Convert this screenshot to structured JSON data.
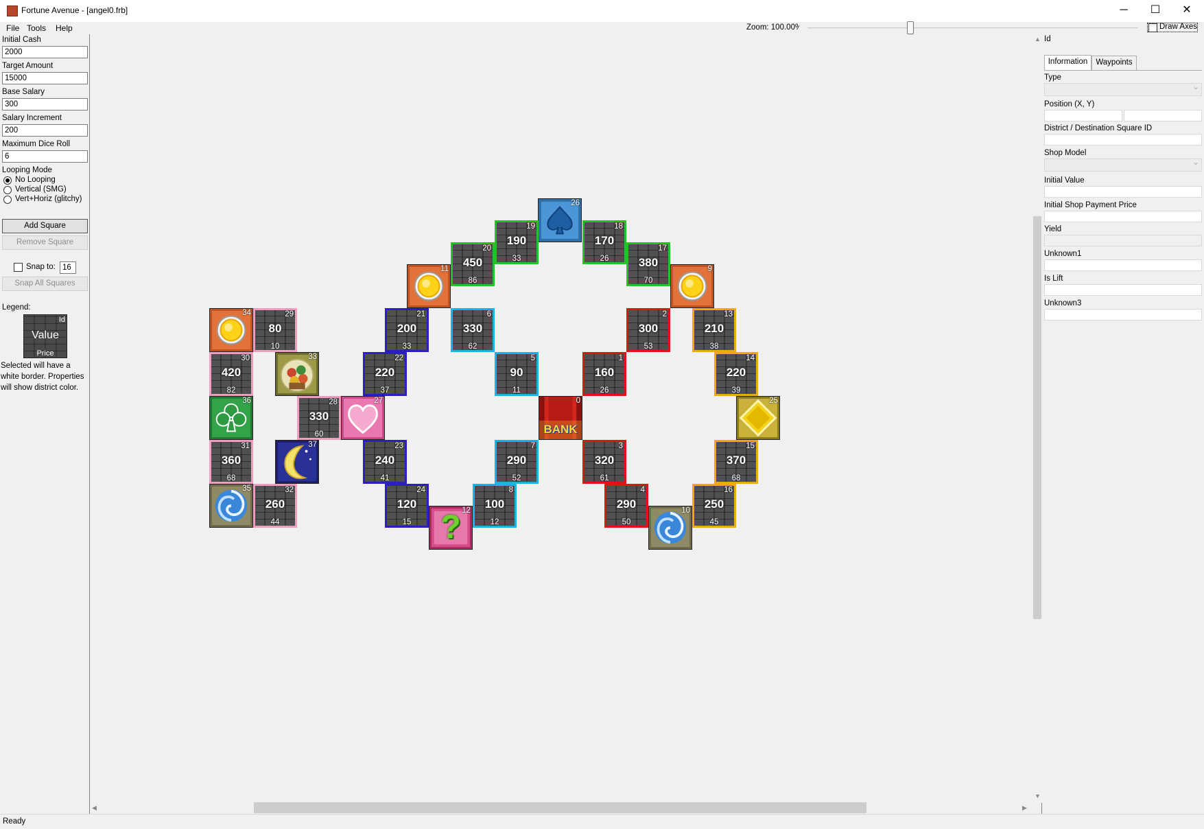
{
  "window": {
    "title": "Fortune Avenue - [angel0.frb]",
    "minimize_glyph": "─",
    "maximize_glyph": "☐",
    "close_glyph": "✕"
  },
  "menu": {
    "file": "File",
    "tools": "Tools",
    "help": "Help"
  },
  "toolbar": {
    "zoom_label": "Zoom: 100.00%",
    "zoom_level": 0.3,
    "draw_axes_label": "Draw Axes",
    "draw_axes_checked": false
  },
  "left_panel": {
    "initial_cash_label": "Initial Cash",
    "initial_cash_value": "2000",
    "target_amount_label": "Target Amount",
    "target_amount_value": "15000",
    "base_salary_label": "Base Salary",
    "base_salary_value": "300",
    "salary_increment_label": "Salary Increment",
    "salary_increment_value": "200",
    "max_dice_label": "Maximum Dice Roll",
    "max_dice_value": "6",
    "looping_mode_label": "Looping Mode",
    "looping_options": [
      "No Looping",
      "Vertical (SMG)",
      "Vert+Horiz (glitchy)"
    ],
    "looping_selected": "No Looping",
    "add_square_label": "Add Square",
    "remove_square_label": "Remove Square",
    "snap_to_label": "Snap to:",
    "snap_value": "16",
    "snap_all_label": "Snap All Squares",
    "legend_label": "Legend:",
    "legend_id": "Id",
    "legend_value": "Value",
    "legend_price": "Price",
    "legend_note": "Selected will have a white border. Properties will show district color."
  },
  "colors": {
    "green": "#22c322",
    "blue": "#2b1fc4",
    "cyan": "#19b3e6",
    "red": "#e01414",
    "pink": "#f29cc0",
    "orange": "#f2a812"
  },
  "board": {
    "squares": [
      {
        "id": "26",
        "kind": "spade"
      },
      {
        "id": "19",
        "value": "190",
        "price": "33",
        "district": "green"
      },
      {
        "id": "18",
        "value": "170",
        "price": "26",
        "district": "green"
      },
      {
        "id": "20",
        "value": "450",
        "price": "86",
        "district": "green"
      },
      {
        "id": "17",
        "value": "380",
        "price": "70",
        "district": "green"
      },
      {
        "id": "11",
        "kind": "sun"
      },
      {
        "id": "9",
        "kind": "sun"
      },
      {
        "id": "34",
        "kind": "sun"
      },
      {
        "id": "29",
        "value": "80",
        "price": "10",
        "district": "pink"
      },
      {
        "id": "21",
        "value": "200",
        "price": "33",
        "district": "blue"
      },
      {
        "id": "6",
        "value": "330",
        "price": "62",
        "district": "cyan"
      },
      {
        "id": "2",
        "value": "300",
        "price": "53",
        "district": "red"
      },
      {
        "id": "13",
        "value": "210",
        "price": "38",
        "district": "orange"
      },
      {
        "id": "30",
        "value": "420",
        "price": "82",
        "district": "pink"
      },
      {
        "id": "33",
        "kind": "bag"
      },
      {
        "id": "22",
        "value": "220",
        "price": "37",
        "district": "blue"
      },
      {
        "id": "5",
        "value": "90",
        "price": "11",
        "district": "cyan"
      },
      {
        "id": "1",
        "value": "160",
        "price": "26",
        "district": "red"
      },
      {
        "id": "14",
        "value": "220",
        "price": "39",
        "district": "orange"
      },
      {
        "id": "36",
        "kind": "club"
      },
      {
        "id": "28",
        "value": "330",
        "price": "60",
        "district": "pink"
      },
      {
        "id": "27",
        "kind": "heart"
      },
      {
        "id": "0",
        "kind": "bank",
        "text": "BANK"
      },
      {
        "id": "25",
        "kind": "diamond"
      },
      {
        "id": "31",
        "value": "360",
        "price": "68",
        "district": "pink"
      },
      {
        "id": "37",
        "kind": "moon"
      },
      {
        "id": "23",
        "value": "240",
        "price": "41",
        "district": "blue"
      },
      {
        "id": "7",
        "value": "290",
        "price": "52",
        "district": "cyan"
      },
      {
        "id": "3",
        "value": "320",
        "price": "61",
        "district": "red"
      },
      {
        "id": "15",
        "value": "370",
        "price": "68",
        "district": "orange"
      },
      {
        "id": "35",
        "kind": "vortex"
      },
      {
        "id": "32",
        "value": "260",
        "price": "44",
        "district": "pink"
      },
      {
        "id": "24",
        "value": "120",
        "price": "15",
        "district": "blue"
      },
      {
        "id": "12",
        "kind": "question",
        "text": "?"
      },
      {
        "id": "8",
        "value": "100",
        "price": "12",
        "district": "cyan"
      },
      {
        "id": "4",
        "value": "290",
        "price": "50",
        "district": "red"
      },
      {
        "id": "10",
        "kind": "vortex"
      },
      {
        "id": "16",
        "value": "250",
        "price": "45",
        "district": "orange"
      }
    ]
  },
  "right_panel": {
    "id_label": "Id",
    "tab_information": "Information",
    "tab_waypoints": "Waypoints",
    "type_label": "Type",
    "position_label": "Position (X, Y)",
    "district_label": "District / Destination Square ID",
    "shop_model_label": "Shop Model",
    "initial_value_label": "Initial Value",
    "initial_shop_price_label": "Initial Shop Payment Price",
    "yield_label": "Yield",
    "unknown1_label": "Unknown1",
    "is_lift_label": "Is Lift",
    "unknown3_label": "Unknown3"
  },
  "status": {
    "text": "Ready"
  }
}
